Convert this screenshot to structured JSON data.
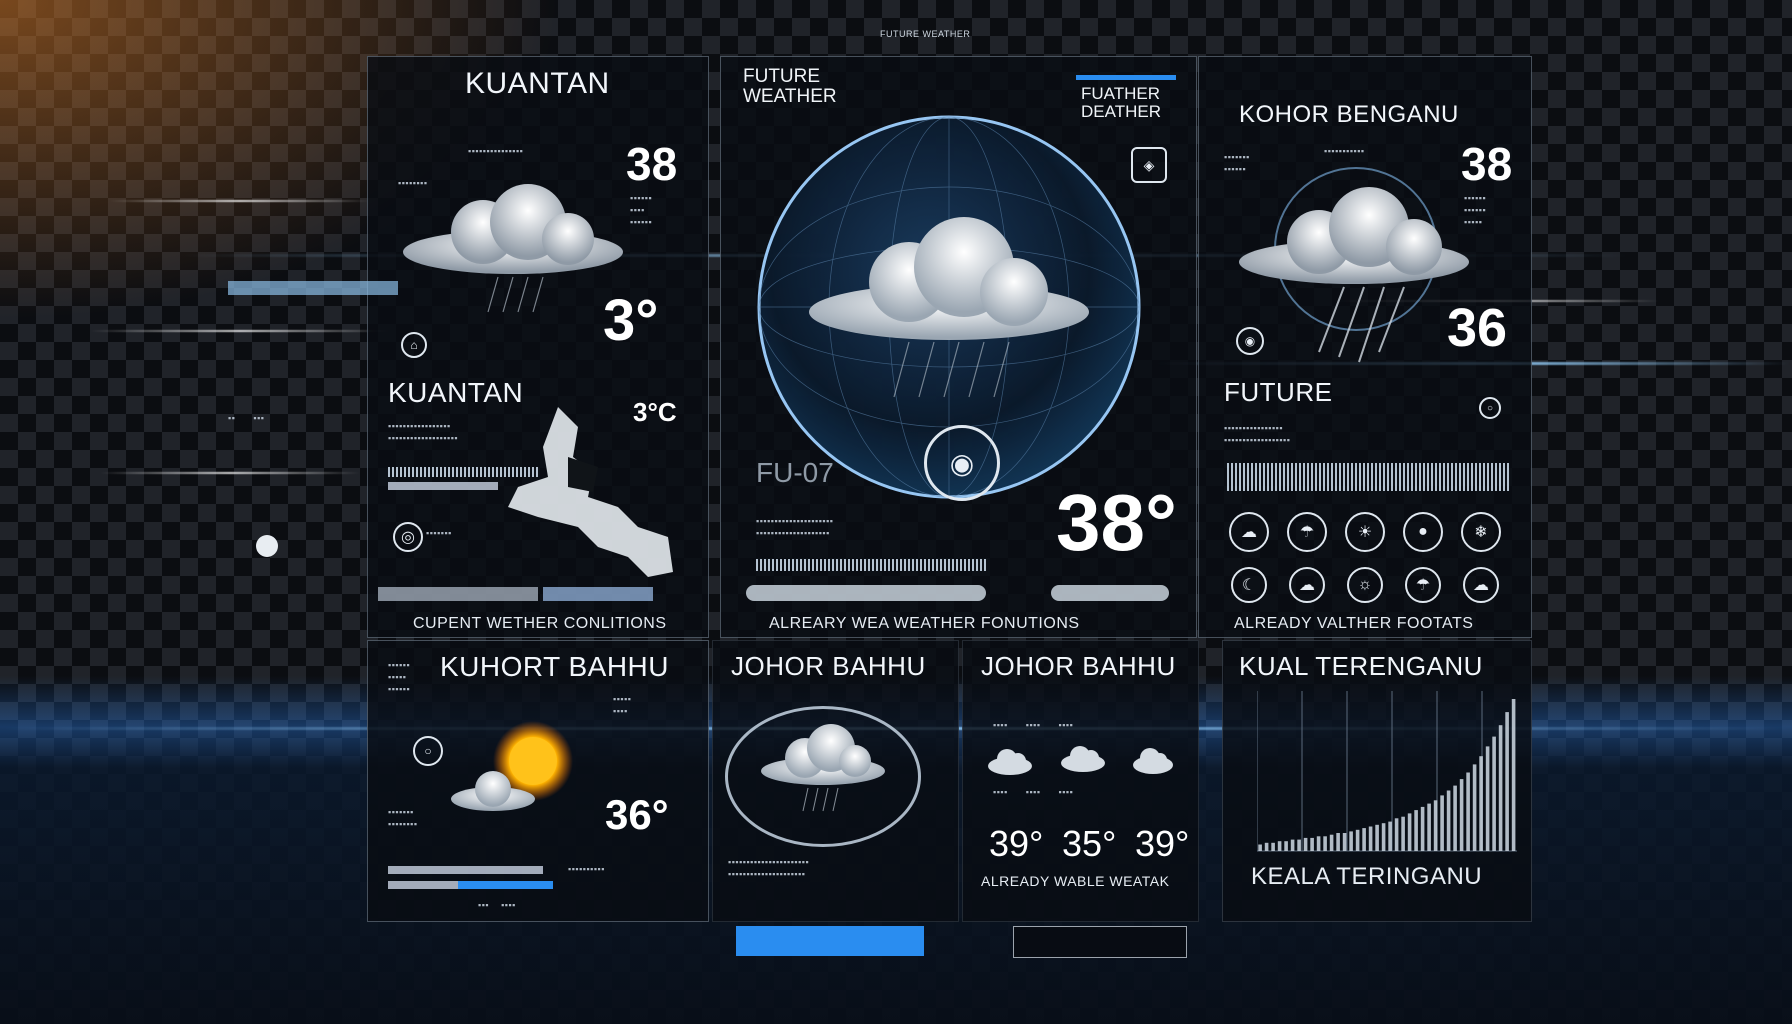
{
  "top_label": "FUTURE WEATHER",
  "panels": {
    "kuantan": {
      "city": "KUANTAN",
      "temp_top": "38",
      "temp_mid": "3°",
      "city_2": "KUANTAN",
      "temp_small": "3°C",
      "caption": "CUPENT WETHER CONLITIONS"
    },
    "center": {
      "title": "FUTURE WEATHER",
      "badge": "FUATHER DEATHER",
      "overlay": "FU-07",
      "temp": "38°",
      "caption": "ALREARY WEA WEATHER FONUTIONS"
    },
    "kohor": {
      "city": "KOHOR BENGANU",
      "temp_top": "38",
      "temp_mid": "36",
      "future_label": "FUTURE",
      "caption": "ALREADY VALTHER FOOTATS"
    },
    "kuhort": {
      "city": "KUHORT BAHHU",
      "temp": "36°"
    },
    "johor1": {
      "city": "JOHOR BAHHU"
    },
    "johor2": {
      "city": "JOHOR BAHHU",
      "temps": [
        "39°",
        "35°",
        "39°"
      ],
      "caption": "ALREADY WABLE WEATAK"
    },
    "kual": {
      "city": "KUAL TERENGANU",
      "caption": "KEALA TERINGANU",
      "chart_values": [
        4,
        5,
        5,
        6,
        6,
        7,
        7,
        8,
        8,
        9,
        9,
        10,
        11,
        11,
        12,
        13,
        14,
        15,
        16,
        17,
        18,
        20,
        21,
        23,
        25,
        27,
        29,
        31,
        34,
        37,
        40,
        44,
        48,
        53,
        58,
        64,
        70,
        77,
        85,
        93
      ]
    }
  },
  "buttons": {
    "primary_label": "",
    "secondary_label": ""
  },
  "icons": {
    "center_target": "target-icon",
    "sun": "sun-icon"
  },
  "colors": {
    "accent": "#2a8df0",
    "sun": "#ffb300"
  }
}
